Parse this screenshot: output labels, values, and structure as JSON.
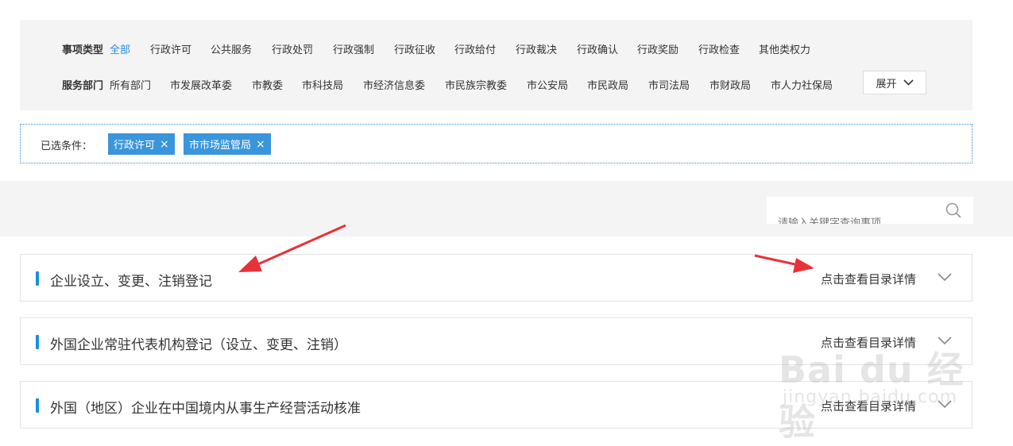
{
  "filters": {
    "type_label": "事项类型",
    "types": [
      "全部",
      "行政许可",
      "公共服务",
      "行政处罚",
      "行政强制",
      "行政征收",
      "行政给付",
      "行政裁决",
      "行政确认",
      "行政奖励",
      "行政检查",
      "其他类权力"
    ],
    "active_type": "全部",
    "dept_label": "服务部门",
    "depts": [
      "所有部门",
      "市发展改革委",
      "市教委",
      "市科技局",
      "市经济信息委",
      "市民族宗教委",
      "市公安局",
      "市民政局",
      "市司法局",
      "市财政局",
      "市人力社保局"
    ],
    "expand_label": "展开"
  },
  "selected": {
    "label": "已选条件：",
    "tags": [
      "行政许可",
      "市市场监管局"
    ]
  },
  "search": {
    "placeholder": "请输入关键字查询事项"
  },
  "items": [
    {
      "title": "企业设立、变更、注销登记",
      "detail": "点击查看目录详情"
    },
    {
      "title": "外国企业常驻代表机构登记（设立、变更、注销）",
      "detail": "点击查看目录详情"
    },
    {
      "title": "外国（地区）企业在中国境内从事生产经营活动核准",
      "detail": "点击查看目录详情"
    }
  ],
  "watermark": {
    "main": "Bai du 经验",
    "sub": "jingyan.baidu.com"
  },
  "colors": {
    "accent": "#2a8ae6",
    "tag_bg": "#3a95dc",
    "annotation_arrow": "#e8323a"
  }
}
